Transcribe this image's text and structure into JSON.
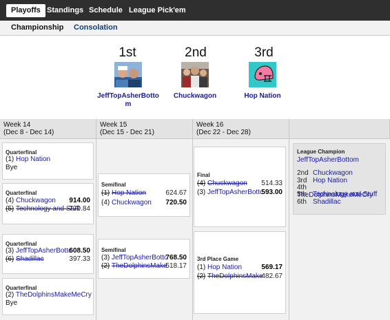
{
  "nav": {
    "tabs": [
      {
        "label": "Playoffs",
        "active": true
      },
      {
        "label": "Standings",
        "active": false
      },
      {
        "label": "Schedule",
        "active": false
      },
      {
        "label": "League Pick'em",
        "active": false
      }
    ]
  },
  "subnav": {
    "tabs": [
      {
        "label": "Championship",
        "active": true
      },
      {
        "label": "Consolation",
        "active": false
      }
    ]
  },
  "podium": [
    {
      "rank": "1st",
      "team_line1": "JeffTopAsherBotto",
      "team_line2": "m",
      "avatar": "photo-two-people-icon"
    },
    {
      "rank": "2nd",
      "team": "Chuckwagon",
      "avatar": "photo-crowd-icon"
    },
    {
      "rank": "3rd",
      "team": "Hop Nation",
      "avatar": "pink-helmet-icon"
    }
  ],
  "weeks": [
    {
      "line1": "Week 14",
      "line2": "(Dec 8 - Dec 14)"
    },
    {
      "line1": "Week 15",
      "line2": "(Dec 15 - Dec 21)"
    },
    {
      "line1": "Week 16",
      "line2": "(Dec 22 - Dec 28)"
    }
  ],
  "matchups": {
    "qf1": {
      "label": "Quarterfinal",
      "seed1": "(1)",
      "team1": "Hop Nation",
      "bye": "Bye"
    },
    "qf2": {
      "label": "Quarterfinal",
      "seed1": "(4)",
      "team1": "Chuckwagon",
      "score1": "914.00",
      "seed2": "(5)",
      "team2": "Technology and Stuff",
      "score2": "770.84"
    },
    "qf3": {
      "label": "Quarterfinal",
      "seed1": "(3)",
      "team1": "JeffTopAsherBottom",
      "score1": "608.50",
      "seed2": "(6)",
      "team2": "Shadillac",
      "score2": "397.33"
    },
    "qf4": {
      "label": "Quarterfinal",
      "seed1": "(2)",
      "team1": "TheDolphinsMakeMeCry",
      "bye": "Bye"
    },
    "sf1": {
      "label": "Semifinal",
      "seed1": "(1)",
      "team1": "Hop Nation",
      "score1": "624.67",
      "seed2": "(4)",
      "team2": "Chuckwagon",
      "score2": "720.50"
    },
    "sf2": {
      "label": "Semifinal",
      "seed1": "(3)",
      "team1": "JeffTopAsherBottom",
      "score1": "768.50",
      "seed2": "(2)",
      "team2": "TheDolphinsMakeMeCry",
      "score2": "518.17"
    },
    "final": {
      "label": "Final",
      "seed1": "(4)",
      "team1": "Chuckwagon",
      "score1": "514.33",
      "seed2": "(3)",
      "team2": "JeffTopAsherBottom",
      "score2": "593.00"
    },
    "third": {
      "label": "3rd Place Game",
      "seed1": "(1)",
      "team1": "Hop Nation",
      "score1": "569.17",
      "seed2": "(2)",
      "team2": "TheDolphinsMakeMeCry",
      "score2": "482.67"
    }
  },
  "champion": {
    "label": "League Champion",
    "team": "JeffTopAsherBottom",
    "places": [
      {
        "place": "2nd",
        "team": "Chuckwagon"
      },
      {
        "place": "3rd",
        "team": "Hop Nation"
      },
      {
        "place": "4th",
        "team": "TheDolphinsMakeMeCry"
      },
      {
        "place": "5th",
        "team": "Technology and Stuff"
      },
      {
        "place": "6th",
        "team": "Shadillac"
      }
    ]
  }
}
